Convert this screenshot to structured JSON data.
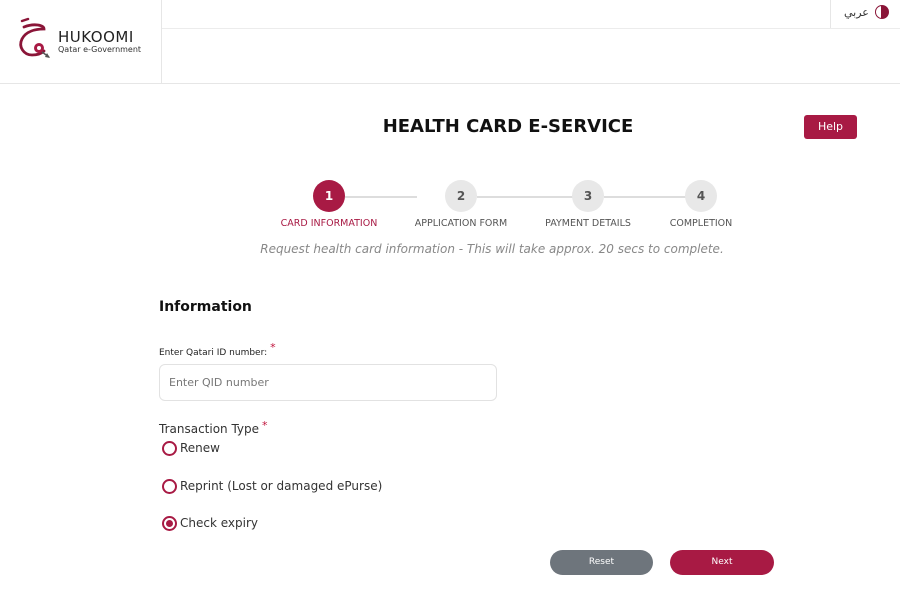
{
  "header": {
    "logo_title": "HUKOOMI",
    "logo_subtitle": "Qatar e-Government",
    "language_label": "عربي"
  },
  "page": {
    "title": "HEALTH CARD E-SERVICE",
    "help_label": "Help",
    "intro": "Request health card information - This will take approx. 20 secs to complete."
  },
  "stepper": {
    "current_step": 1,
    "steps": [
      {
        "number": "1",
        "label": "CARD INFORMATION"
      },
      {
        "number": "2",
        "label": "APPLICATION FORM"
      },
      {
        "number": "3",
        "label": "PAYMENT DETAILS"
      },
      {
        "number": "4",
        "label": "COMPLETION"
      }
    ]
  },
  "form": {
    "section_title": "Information",
    "qid_label": "Enter Qatari ID number:",
    "qid_placeholder": "Enter QID number",
    "qid_value": "",
    "required_marker": "*",
    "transaction_type_label": "Transaction Type",
    "options": [
      {
        "label": "Renew",
        "selected": false
      },
      {
        "label": "Reprint (Lost or damaged ePurse)",
        "selected": false
      },
      {
        "label": "Check expiry",
        "selected": true
      }
    ],
    "reset_label": "Reset",
    "next_label": "Next"
  },
  "colors": {
    "brand": "#a81a44",
    "reset": "#6e757c"
  }
}
